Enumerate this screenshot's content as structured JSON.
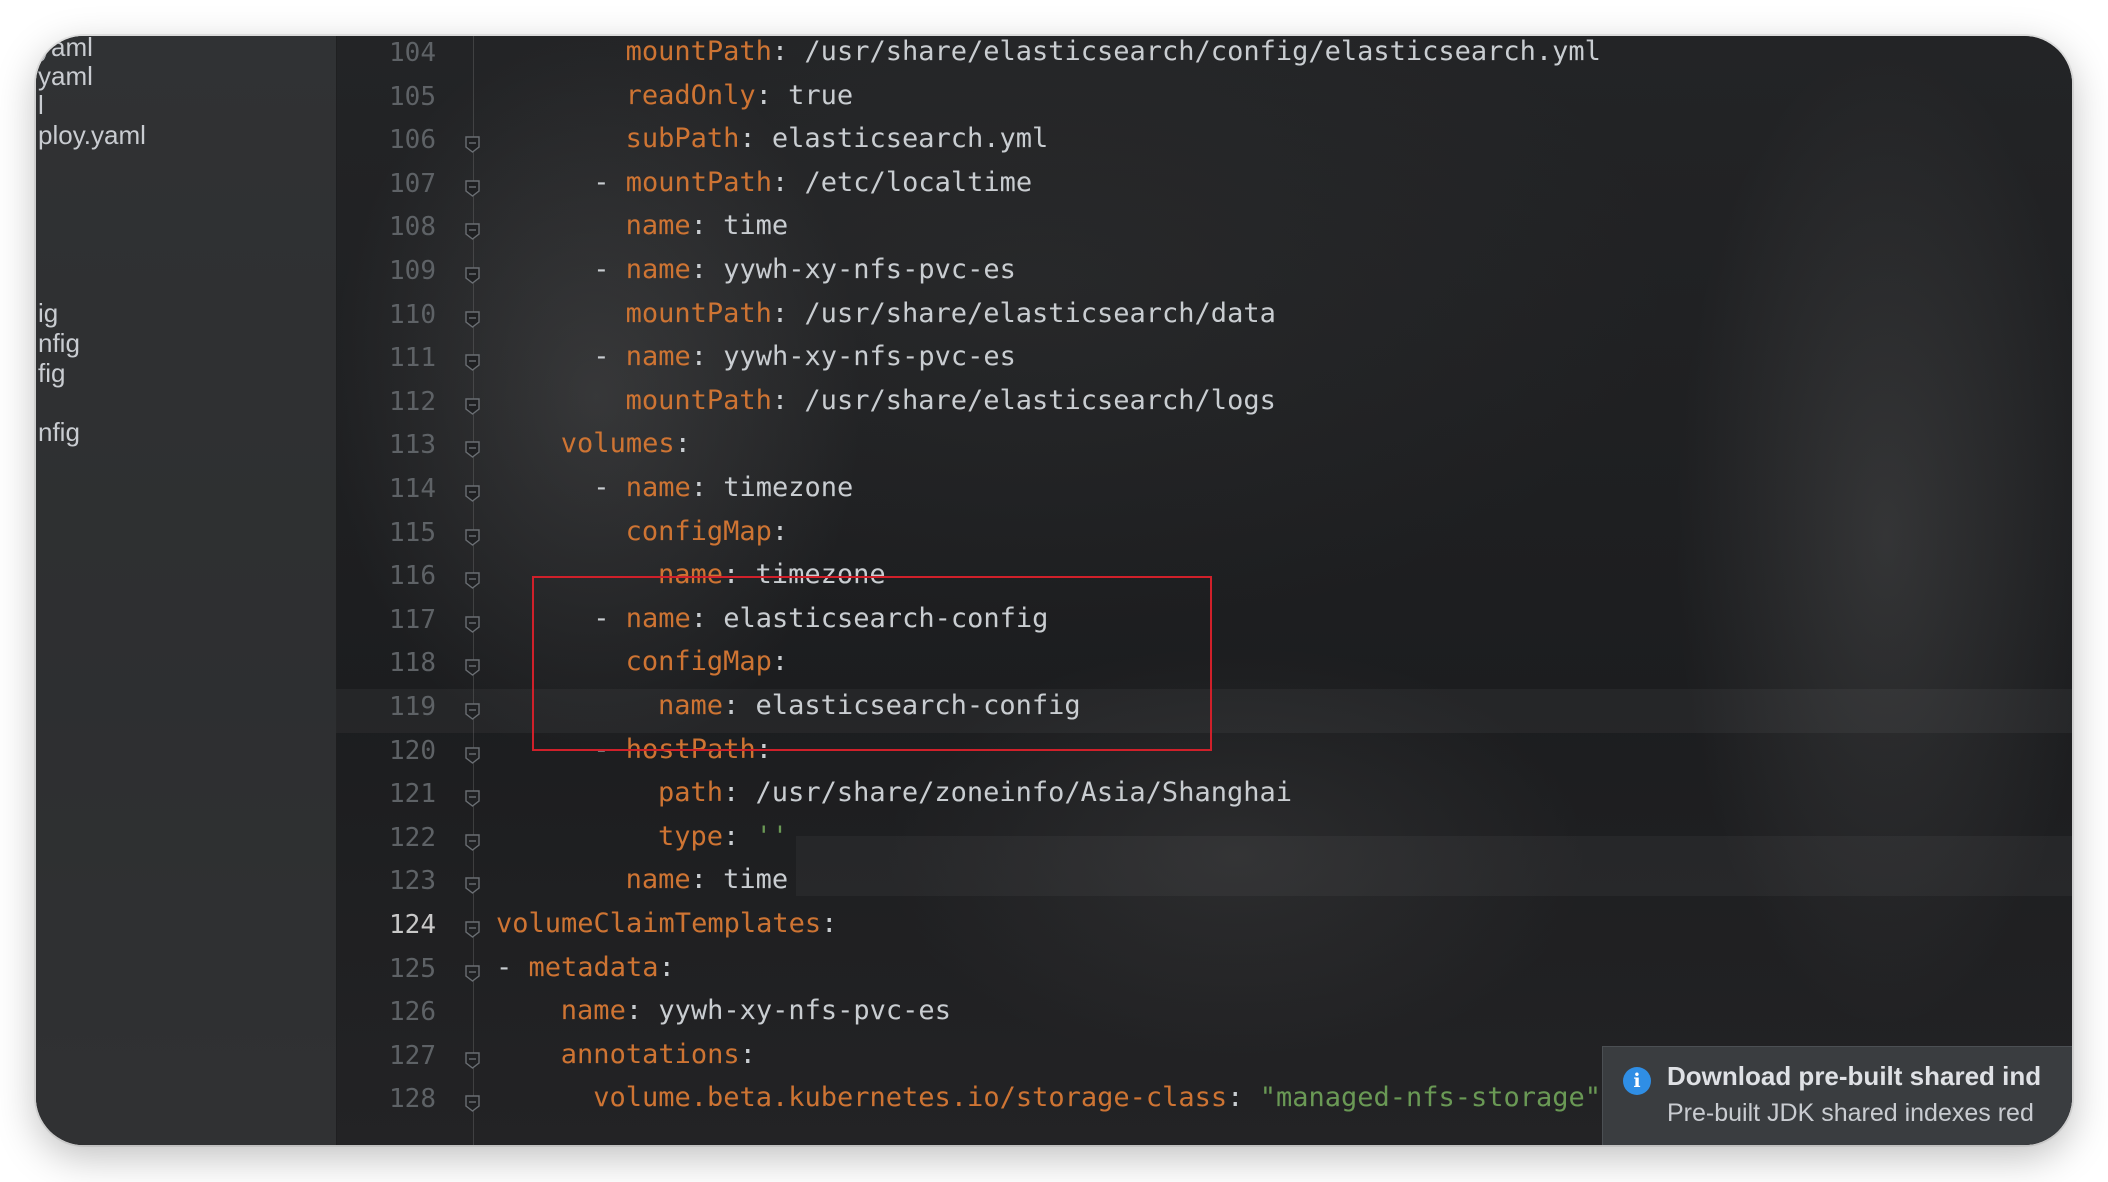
{
  "project_tree": {
    "items": [
      {
        "label": "yaml"
      },
      {
        "label": "yaml"
      },
      {
        "label": "l"
      },
      {
        "label": "ploy.yaml"
      },
      {
        "label": "ig"
      },
      {
        "label": "nfig"
      },
      {
        "label": "fig"
      },
      {
        "label": "nfig"
      }
    ]
  },
  "editor": {
    "current_line": "124",
    "lines": [
      {
        "num": "104",
        "indent": "        ",
        "dash": "",
        "key": "mountPath",
        "colon": ":",
        "value": " /usr/share/elasticsearch/config/elasticsearch.yml",
        "string": ""
      },
      {
        "num": "105",
        "indent": "        ",
        "dash": "",
        "key": "readOnly",
        "colon": ":",
        "value": " true",
        "string": ""
      },
      {
        "num": "106",
        "indent": "        ",
        "dash": "",
        "key": "subPath",
        "colon": ":",
        "value": " elasticsearch.yml",
        "string": ""
      },
      {
        "num": "107",
        "indent": "      ",
        "dash": "- ",
        "key": "mountPath",
        "colon": ":",
        "value": " /etc/localtime",
        "string": ""
      },
      {
        "num": "108",
        "indent": "        ",
        "dash": "",
        "key": "name",
        "colon": ":",
        "value": " time",
        "string": ""
      },
      {
        "num": "109",
        "indent": "      ",
        "dash": "- ",
        "key": "name",
        "colon": ":",
        "value": " yywh-xy-nfs-pvc-es",
        "string": ""
      },
      {
        "num": "110",
        "indent": "        ",
        "dash": "",
        "key": "mountPath",
        "colon": ":",
        "value": " /usr/share/elasticsearch/data",
        "string": ""
      },
      {
        "num": "111",
        "indent": "      ",
        "dash": "- ",
        "key": "name",
        "colon": ":",
        "value": " yywh-xy-nfs-pvc-es",
        "string": ""
      },
      {
        "num": "112",
        "indent": "        ",
        "dash": "",
        "key": "mountPath",
        "colon": ":",
        "value": " /usr/share/elasticsearch/logs",
        "string": ""
      },
      {
        "num": "113",
        "indent": "    ",
        "dash": "",
        "key": "volumes",
        "colon": ":",
        "value": "",
        "string": ""
      },
      {
        "num": "114",
        "indent": "      ",
        "dash": "- ",
        "key": "name",
        "colon": ":",
        "value": " timezone",
        "string": ""
      },
      {
        "num": "115",
        "indent": "        ",
        "dash": "",
        "key": "configMap",
        "colon": ":",
        "value": "",
        "string": ""
      },
      {
        "num": "116",
        "indent": "          ",
        "dash": "",
        "key": "name",
        "colon": ":",
        "value": " timezone",
        "string": ""
      },
      {
        "num": "117",
        "indent": "      ",
        "dash": "- ",
        "key": "name",
        "colon": ":",
        "value": " elasticsearch-config",
        "string": ""
      },
      {
        "num": "118",
        "indent": "        ",
        "dash": "",
        "key": "configMap",
        "colon": ":",
        "value": "",
        "string": ""
      },
      {
        "num": "119",
        "indent": "          ",
        "dash": "",
        "key": "name",
        "colon": ":",
        "value": " elasticsearch-config",
        "string": ""
      },
      {
        "num": "120",
        "indent": "      ",
        "dash": "- ",
        "key": "hostPath",
        "colon": ":",
        "value": "",
        "string": ""
      },
      {
        "num": "121",
        "indent": "          ",
        "dash": "",
        "key": "path",
        "colon": ":",
        "value": " /usr/share/zoneinfo/Asia/Shanghai",
        "string": ""
      },
      {
        "num": "122",
        "indent": "          ",
        "dash": "",
        "key": "type",
        "colon": ":",
        "value": " ",
        "string": "''"
      },
      {
        "num": "123",
        "indent": "        ",
        "dash": "",
        "key": "name",
        "colon": ":",
        "value": " time",
        "string": ""
      },
      {
        "num": "124",
        "indent": "",
        "dash": "",
        "key": "volumeClaimTemplates",
        "colon": ":",
        "value": "",
        "string": ""
      },
      {
        "num": "125",
        "indent": "",
        "dash": "- ",
        "key": "metadata",
        "colon": ":",
        "value": "",
        "string": ""
      },
      {
        "num": "126",
        "indent": "    ",
        "dash": "",
        "key": "name",
        "colon": ":",
        "value": " yywh-xy-nfs-pvc-es",
        "string": ""
      },
      {
        "num": "127",
        "indent": "    ",
        "dash": "",
        "key": "annotations",
        "colon": ":",
        "value": "",
        "string": ""
      },
      {
        "num": "128",
        "indent": "      ",
        "dash": "",
        "key": "volume.beta.kubernetes.io/storage-class",
        "colon": ":",
        "value": " ",
        "string": "\"managed-nfs-storage\""
      }
    ]
  },
  "notification": {
    "icon": "info-icon",
    "title": "Download pre-built shared ind",
    "body": "Pre-built JDK shared indexes red"
  },
  "colors": {
    "key": "#ce7433",
    "text": "#c9cdd1",
    "string": "#6a9955",
    "highlight_box": "#d0202a",
    "info": "#2f8ee5"
  }
}
